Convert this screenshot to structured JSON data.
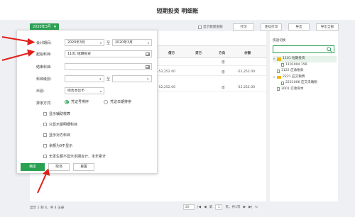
{
  "page": {
    "title": "短期投资 明细账"
  },
  "toolbar": {
    "period_button": "2020年3月",
    "show_qty_label": "显示数量金额",
    "print": "打印",
    "continuous_print": "连续打印",
    "export": "导出",
    "export_all": "导出全部"
  },
  "table": {
    "headers": [
      "借方",
      "贷方",
      "方向",
      "余额"
    ],
    "rows": [
      {
        "debit": "",
        "credit": "",
        "dir": "借",
        "balance": ""
      },
      {
        "debit": "-52,252.00",
        "credit": "",
        "dir": "借",
        "balance": "-52,252.00"
      },
      {
        "debit": "-52,252.00",
        "credit": "",
        "dir": "借",
        "balance": "-52,252.00"
      }
    ]
  },
  "footer": {
    "records": "显示 1 到 4，共 4 记录",
    "page_size": "20",
    "page_prefix": "第",
    "page_value": "1",
    "page_suffix": "页，共1页"
  },
  "sidebar": {
    "title": "快速切换",
    "search_placeholder": "",
    "tree": [
      {
        "label": "1101 短期投资",
        "type": "folder",
        "open": true,
        "selected": true,
        "level": 0
      },
      {
        "label": "1101004 156",
        "type": "file",
        "level": 1
      },
      {
        "label": "1122 应收账款",
        "type": "file",
        "level": 0
      },
      {
        "label": "2221 应交税费",
        "type": "folder",
        "open": true,
        "level": 0
      },
      {
        "label": "2221006 应交未确税",
        "type": "file",
        "level": 1
      },
      {
        "label": "3001 实收资本",
        "type": "file",
        "level": 0
      }
    ]
  },
  "popup": {
    "period_label": "会计期间:",
    "period_from": "2020年3月",
    "period_to_sep": "至",
    "period_to": "2020年3月",
    "start_subject_label": "起始科目:",
    "start_subject_value": "1101 短期投资",
    "end_subject_label": "结束科目:",
    "end_subject_value": "",
    "subject_level_label": "科目级别:",
    "level_from": "",
    "level_to_sep": "至",
    "level_to": "",
    "currency_label": "币别:",
    "currency_value": "综合本位币",
    "sort_label": "排序方式:",
    "sort_voucher_no": "凭证号排序",
    "sort_voucher_date": "凭证日期排序",
    "options": [
      "显示辅助核算",
      "只显示最明细科目",
      "显示对方科目",
      "余额为0不显示",
      "无发生额不显示本期合计、本年累计"
    ],
    "confirm": "确定",
    "cancel": "取消",
    "reset": "重置"
  },
  "colors": {
    "accent": "#2aa052",
    "arrow": "#e0201b",
    "folder": "#f4b400"
  }
}
